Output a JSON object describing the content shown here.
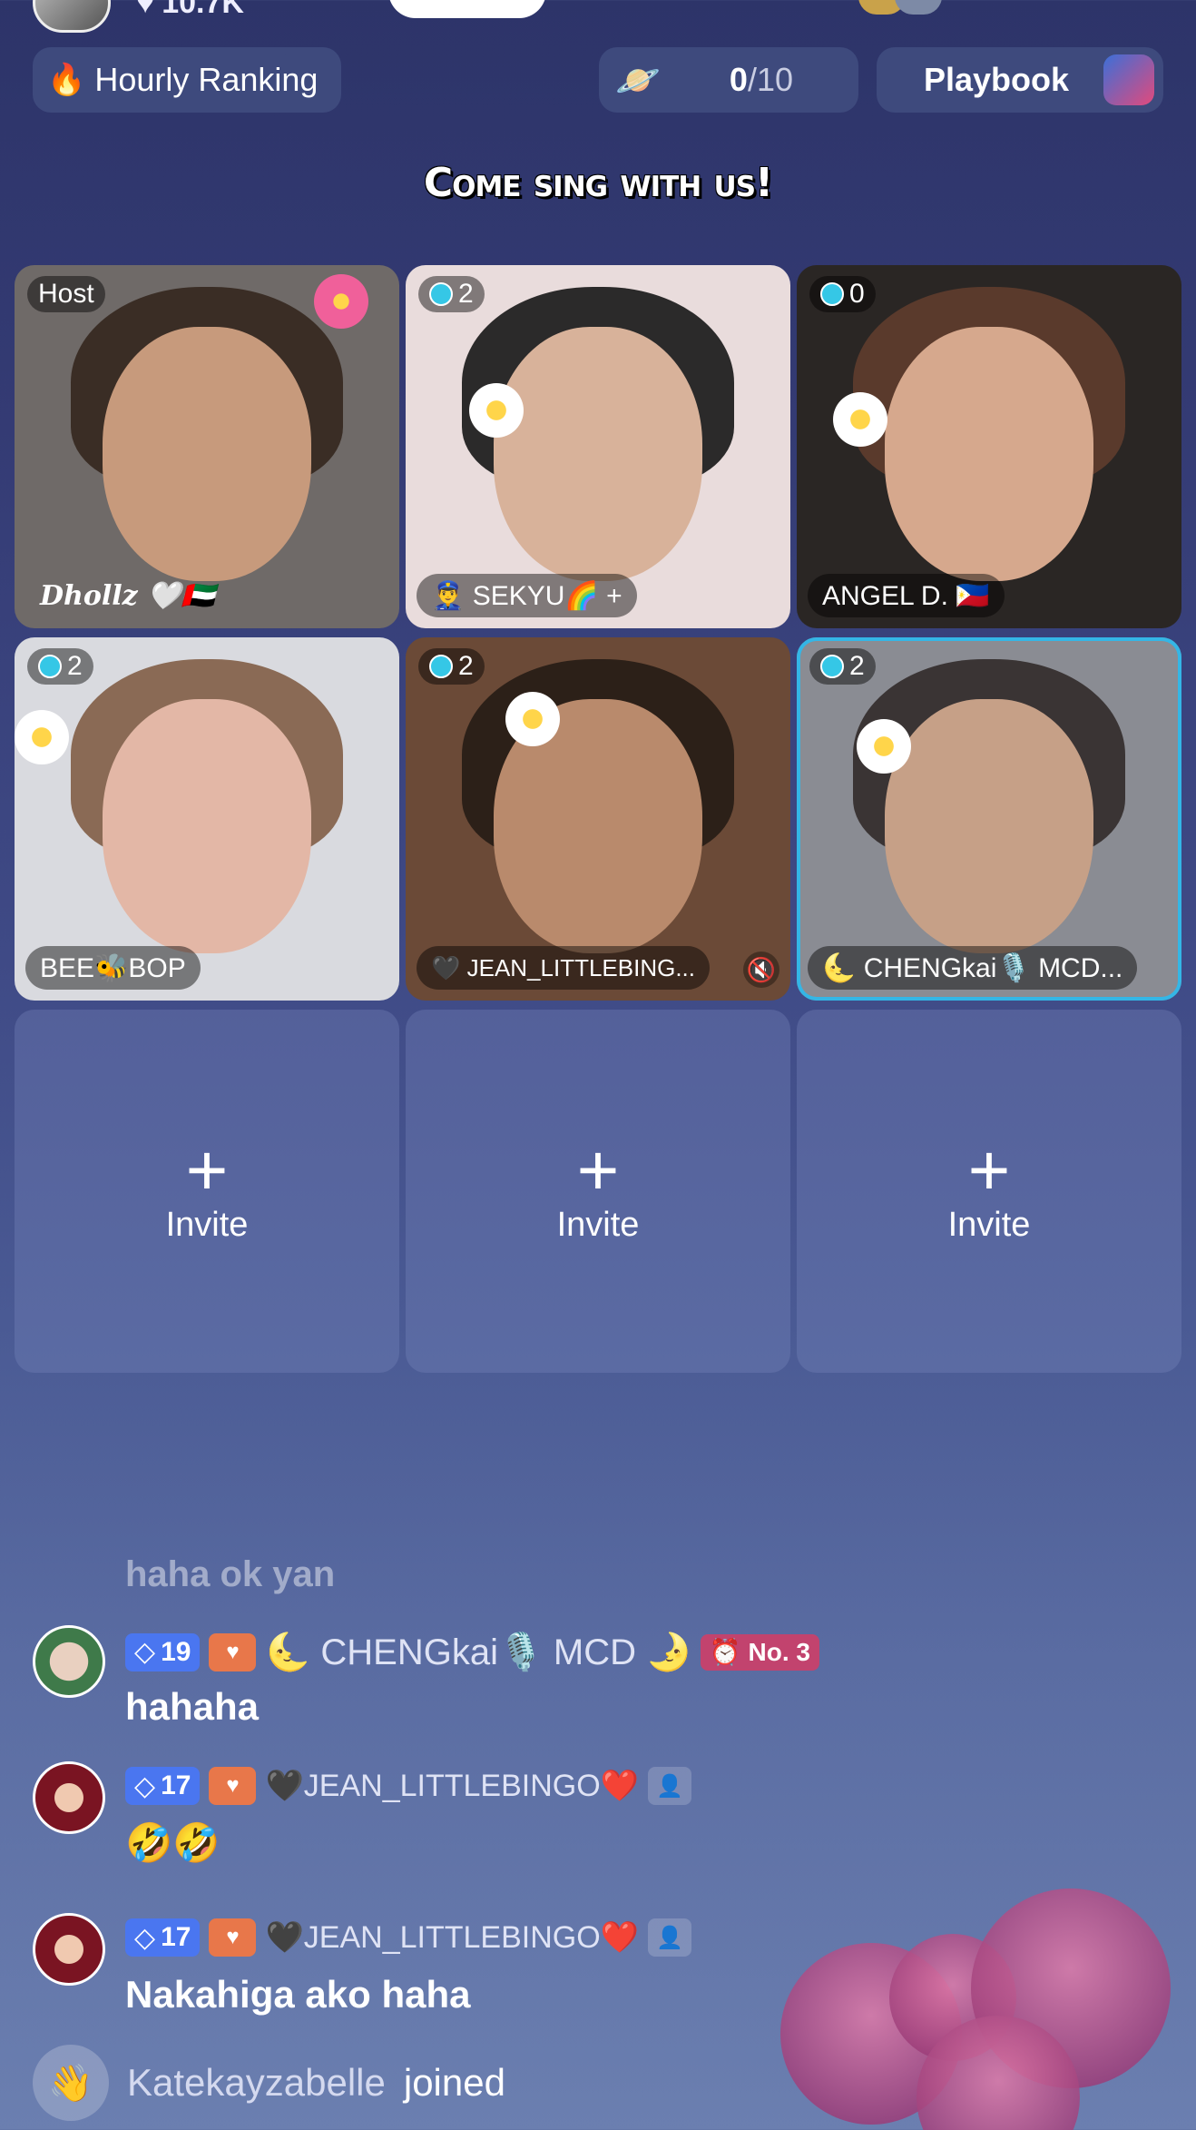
{
  "top": {
    "likes": "10.7K"
  },
  "ranking_chip": {
    "icon": "fire-icon",
    "label": "Hourly Ranking"
  },
  "gift_chip": {
    "progress": "0",
    "total": "/10"
  },
  "playbook": {
    "label": "Playbook"
  },
  "title": "Come sing with us!",
  "seats": [
    {
      "badge": "Host",
      "name": "Dhollz 🤍🇦🇪",
      "bg": "#6f6a68",
      "face": "#c79a7c",
      "hair": "#3a2d25"
    },
    {
      "badge": "2",
      "name": "👮‍♂️ SEKYU🌈 +",
      "bg": "#e9dcdc",
      "face": "#d8b29a",
      "hair": "#2b2a2a"
    },
    {
      "badge": "0",
      "name": "ANGEL D. 🇵🇭",
      "bg": "#2a2624",
      "face": "#d6a88d",
      "hair": "#5a3a2c"
    },
    {
      "badge": "2",
      "name": "BEE🐝BOP",
      "bg": "#d9dadf",
      "face": "#e3b7a6",
      "hair": "#8a6a55"
    },
    {
      "badge": "2",
      "name": "🖤 JEAN_LITTLEBING...",
      "bg": "#6b4a37",
      "face": "#b98a6c",
      "hair": "#2c2018"
    },
    {
      "badge": "2",
      "name": "🌜 CHENGkai🎙️ MCD...",
      "bg": "#8a8c93",
      "face": "#c6a087",
      "hair": "#3a3434"
    }
  ],
  "invite": {
    "label": "Invite",
    "plus": "+"
  },
  "chat": {
    "faded": "haha ok yan",
    "messages": [
      {
        "level": "19",
        "name": "🌜 CHENGkai🎙️ MCD 🌛",
        "rank": "⏰ No. 3",
        "text": "hahaha"
      },
      {
        "level": "17",
        "name": "🖤JEAN_LITTLEBINGO❤️",
        "text": "🤣🤣"
      },
      {
        "level": "17",
        "name": "🖤JEAN_LITTLEBINGO❤️",
        "text": "Nakahiga ako haha"
      }
    ],
    "joined_user": "Katekayzabelle",
    "joined_action": "joined"
  },
  "colors": {
    "accent_cyan": "#35c7e6",
    "level_blue": "#4a76f0",
    "rank_pink": "#c2436e"
  }
}
